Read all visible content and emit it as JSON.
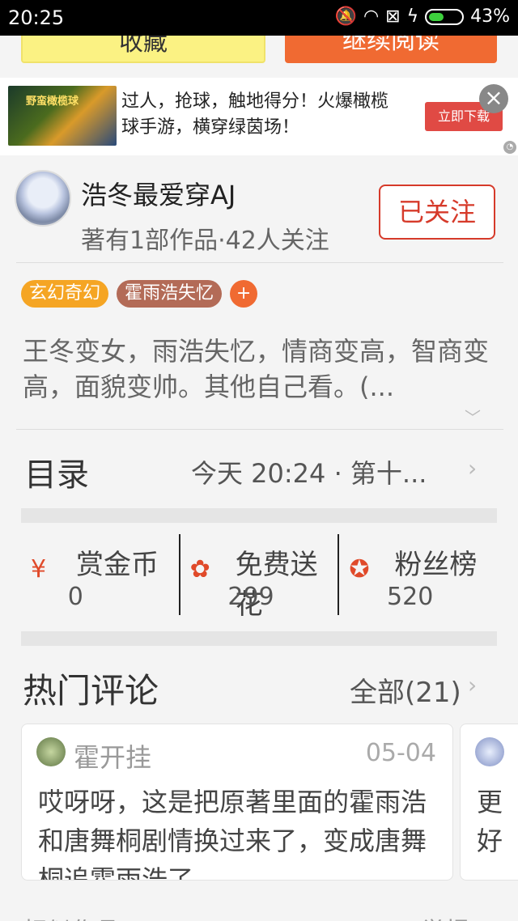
{
  "status_bar": {
    "time": "20:25",
    "battery": "43%"
  },
  "top_buttons": {
    "collect": "收藏",
    "continue": "继续阅读"
  },
  "ad": {
    "image_label": "野蛮橄榄球",
    "text": "过人，抢球，触地得分！火爆橄榄球手游，横穿绿茵场！",
    "download": "立即下载",
    "close_icon": "close-icon"
  },
  "author": {
    "name": "浩冬最爱穿AJ",
    "meta": "著有1部作品·42人关注",
    "follow": "已关注"
  },
  "tags": [
    "玄幻奇幻",
    "霍雨浩失忆",
    "+"
  ],
  "description": "王冬变女，雨浩失忆，情商变高，智商变高，面貌变帅。其他自己看。(...",
  "catalog": {
    "title": "目录",
    "latest": "今天 20:24 · 第十..."
  },
  "stats": [
    {
      "label": "赏金币",
      "value": "0",
      "icon": "red-packet-icon"
    },
    {
      "label": "免费送花",
      "value": "299",
      "icon": "flower-icon"
    },
    {
      "label": "粉丝榜",
      "value": "520",
      "icon": "medal-icon"
    }
  ],
  "comments": {
    "title": "热门评论",
    "all": "全部(21)",
    "items": [
      {
        "user": "霍开挂",
        "date": "05-04",
        "text": "哎呀呀，这是把原著里面的霍雨浩和唐舞桐剧情换过来了，变成唐舞桐追霍雨浩了"
      },
      {
        "text": "更\n好"
      }
    ]
  },
  "bottom": {
    "left": "相似作品",
    "right": "举报"
  }
}
